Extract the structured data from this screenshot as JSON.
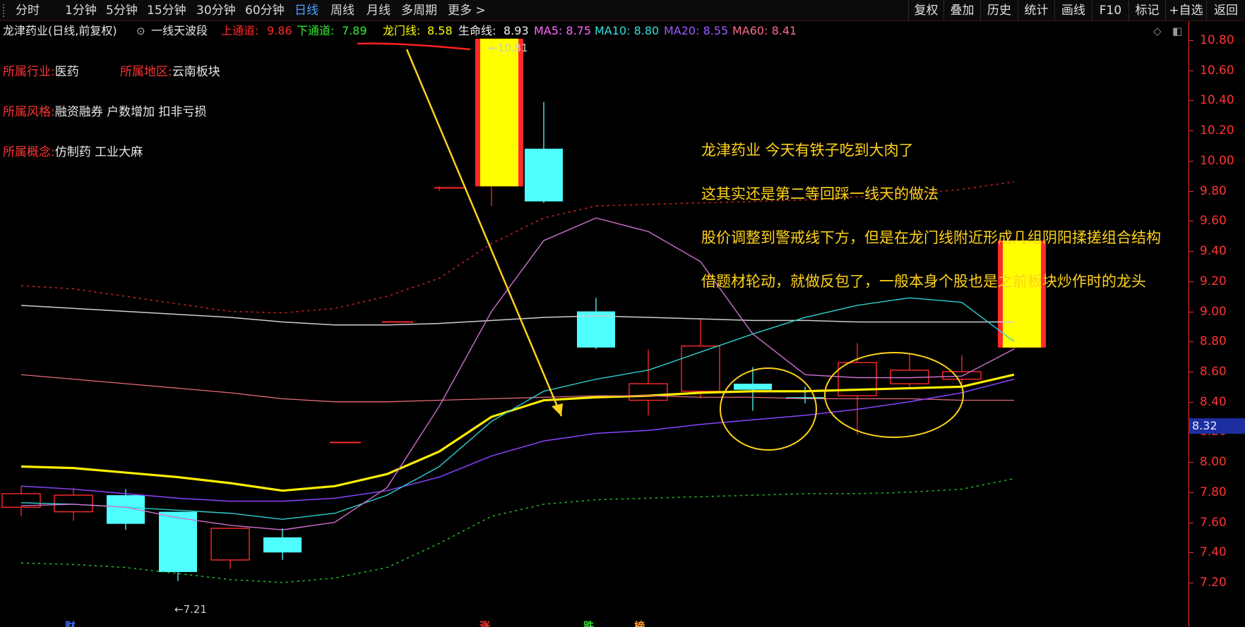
{
  "toolbar": {
    "periods": [
      "分时",
      "1分钟",
      "5分钟",
      "15分钟",
      "30分钟",
      "60分钟",
      "日线",
      "周线",
      "月线",
      "多周期",
      "更多 >"
    ],
    "active_period": "日线",
    "buttons": [
      "复权",
      "叠加",
      "历史",
      "统计",
      "画线",
      "F10",
      "标记",
      "+自选",
      "返回"
    ]
  },
  "infobar": {
    "stock_title": "龙津药业(日线,前复权)",
    "indicator_name": "一线天波段",
    "upper_label": "上通道:",
    "upper_value": "9.86",
    "lower_label": "下通道:",
    "lower_value": "7.89",
    "dragon_label": "龙门线:",
    "dragon_value": "8.58",
    "life_label": "生命线:",
    "life_value": "8.93",
    "ma5": "MA5: 8.75",
    "ma10": "MA10: 8.80",
    "ma20": "MA20: 8.55",
    "ma60": "MA60: 8.41"
  },
  "stock_info": {
    "industry_label": "所属行业:",
    "industry": "医药",
    "region_label": "所属地区:",
    "region": "云南板块",
    "style_label": "所属风格:",
    "style": "融资融券 户数增加 扣非亏损",
    "concept_label": "所属概念:",
    "concept": "仿制药 工业大麻"
  },
  "annotations": [
    "龙津药业 今天有铁子吃到大肉了",
    "这其实还是第二等回踩一线天的做法",
    "股价调整到警戒线下方，但是在龙门线附近形成几组阴阳揉搓组合结构",
    "借题材轮动，就做反包了，一般本身个股也是之前板块炒作时的龙头"
  ],
  "extremes": {
    "high": "10.81",
    "low": "7.21"
  },
  "current_price": "8.32",
  "bottom_marks": [
    "财",
    "涨",
    "跌",
    "榜"
  ],
  "colors": {
    "up": "#ff2a2a",
    "down": "#4fffff",
    "limit_up_fill": "#ffff00",
    "axis": "#ff2a2a",
    "note": "#ffd21a"
  },
  "chart_data": {
    "type": "candlestick",
    "ylim": [
      7.15,
      10.95
    ],
    "y_ticks": [
      7.2,
      7.4,
      7.6,
      7.8,
      8.0,
      8.2,
      8.4,
      8.6,
      8.8,
      9.0,
      9.2,
      9.4,
      9.6,
      9.8,
      10.0,
      10.2,
      10.4,
      10.6,
      10.8
    ],
    "candles": [
      {
        "o": 7.7,
        "h": 7.84,
        "l": 7.64,
        "c": 7.79
      },
      {
        "o": 7.67,
        "h": 7.83,
        "l": 7.61,
        "c": 7.78
      },
      {
        "o": 7.78,
        "h": 7.82,
        "l": 7.55,
        "c": 7.59
      },
      {
        "o": 7.67,
        "h": 7.67,
        "l": 7.21,
        "c": 7.27
      },
      {
        "o": 7.35,
        "h": 7.56,
        "l": 7.29,
        "c": 7.56
      },
      {
        "o": 7.5,
        "h": 7.56,
        "l": 7.35,
        "c": 7.4
      },
      {
        "o": 8.13,
        "h": 8.13,
        "l": 8.13,
        "c": 8.13
      },
      {
        "o": 8.93,
        "h": 8.93,
        "l": 8.93,
        "c": 8.93
      },
      {
        "o": 9.82,
        "h": 9.83,
        "l": 9.8,
        "c": 9.82
      },
      {
        "o": 9.83,
        "h": 10.81,
        "l": 9.7,
        "c": 10.81
      },
      {
        "o": 10.08,
        "h": 10.39,
        "l": 9.72,
        "c": 9.73
      },
      {
        "o": 9.0,
        "h": 9.09,
        "l": 8.75,
        "c": 8.76
      },
      {
        "o": 8.41,
        "h": 8.75,
        "l": 8.31,
        "c": 8.52
      },
      {
        "o": 8.47,
        "h": 8.95,
        "l": 8.42,
        "c": 8.77
      },
      {
        "o": 8.52,
        "h": 8.63,
        "l": 8.34,
        "c": 8.48
      },
      {
        "o": 8.43,
        "h": 8.5,
        "l": 8.39,
        "c": 8.42
      },
      {
        "o": 8.44,
        "h": 8.79,
        "l": 8.18,
        "c": 8.66
      },
      {
        "o": 8.52,
        "h": 8.72,
        "l": 8.5,
        "c": 8.61
      },
      {
        "o": 8.55,
        "h": 8.71,
        "l": 8.49,
        "c": 8.6
      },
      {
        "o": 8.76,
        "h": 9.47,
        "l": 8.75,
        "c": 9.47
      }
    ],
    "series": [
      {
        "name": "上通道",
        "values": [
          9.17,
          9.15,
          9.1,
          9.05,
          9.0,
          8.99,
          9.02,
          9.1,
          9.22,
          9.45,
          9.62,
          9.7,
          9.71,
          9.72,
          9.73,
          9.74,
          9.76,
          9.78,
          9.81,
          9.86
        ]
      },
      {
        "name": "生命线",
        "values": [
          9.04,
          9.02,
          9.0,
          8.98,
          8.96,
          8.93,
          8.91,
          8.91,
          8.92,
          8.94,
          8.96,
          8.97,
          8.96,
          8.95,
          8.94,
          8.94,
          8.93,
          8.93,
          8.93,
          8.93
        ]
      },
      {
        "name": "龙门线",
        "values": [
          7.97,
          7.96,
          7.93,
          7.9,
          7.86,
          7.81,
          7.84,
          7.92,
          8.07,
          8.3,
          8.41,
          8.43,
          8.44,
          8.46,
          8.47,
          8.47,
          8.48,
          8.49,
          8.5,
          8.58
        ]
      },
      {
        "name": "MA60",
        "values": [
          8.58,
          8.55,
          8.52,
          8.49,
          8.46,
          8.42,
          8.4,
          8.4,
          8.41,
          8.42,
          8.43,
          8.44,
          8.44,
          8.43,
          8.43,
          8.42,
          8.42,
          8.42,
          8.41,
          8.41
        ]
      },
      {
        "name": "MA20",
        "values": [
          7.84,
          7.82,
          7.79,
          7.76,
          7.74,
          7.74,
          7.76,
          7.81,
          7.9,
          8.04,
          8.14,
          8.19,
          8.21,
          8.25,
          8.28,
          8.31,
          8.35,
          8.4,
          8.46,
          8.55
        ]
      },
      {
        "name": "MA10",
        "values": [
          7.73,
          7.72,
          7.7,
          7.68,
          7.66,
          7.62,
          7.66,
          7.78,
          7.97,
          8.27,
          8.47,
          8.55,
          8.61,
          8.73,
          8.85,
          8.96,
          9.04,
          9.09,
          9.06,
          8.8
        ]
      },
      {
        "name": "MA5",
        "values": [
          7.71,
          7.72,
          7.7,
          7.63,
          7.58,
          7.55,
          7.6,
          7.83,
          8.37,
          9.0,
          9.47,
          9.62,
          9.53,
          9.33,
          8.85,
          8.58,
          8.56,
          8.56,
          8.57,
          8.75
        ]
      },
      {
        "name": "下通道",
        "values": [
          7.33,
          7.32,
          7.3,
          7.26,
          7.22,
          7.2,
          7.23,
          7.3,
          7.46,
          7.64,
          7.72,
          7.75,
          7.76,
          7.77,
          7.78,
          7.79,
          7.79,
          7.8,
          7.82,
          7.89
        ]
      }
    ]
  }
}
